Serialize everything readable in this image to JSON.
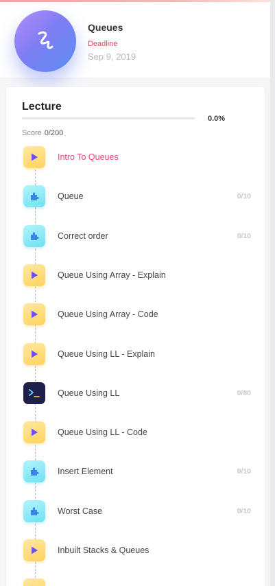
{
  "header": {
    "title": "Queues",
    "deadline_label": "Deadline",
    "deadline_date": "Sep 9, 2019",
    "avatar_icon": "squiggle-logo-icon"
  },
  "lecture": {
    "title": "Lecture",
    "progress_text": "0.0%",
    "progress_value": 0.0,
    "score_label": "Score",
    "score_value": "0/200"
  },
  "colors": {
    "active": "#e8437a",
    "deadline": "#e8435a",
    "video_icon": "#ffd35c",
    "puzzle_icon": "#6fe1f3",
    "code_icon": "#1e1f4a"
  },
  "items": [
    {
      "label": "Intro To Queues",
      "type": "video",
      "icon": "play-icon",
      "score": "",
      "active": true
    },
    {
      "label": "Queue",
      "type": "puzzle",
      "icon": "puzzle-icon",
      "score": "0/10",
      "active": false
    },
    {
      "label": "Correct order",
      "type": "puzzle",
      "icon": "puzzle-icon",
      "score": "0/10",
      "active": false
    },
    {
      "label": "Queue Using Array - Explain",
      "type": "video",
      "icon": "play-icon",
      "score": "",
      "active": false
    },
    {
      "label": "Queue Using Array - Code",
      "type": "video",
      "icon": "play-icon",
      "score": "",
      "active": false
    },
    {
      "label": "Queue Using LL - Explain",
      "type": "video",
      "icon": "play-icon",
      "score": "",
      "active": false
    },
    {
      "label": "Queue Using LL",
      "type": "code",
      "icon": "terminal-icon",
      "score": "0/80",
      "active": false
    },
    {
      "label": "Queue Using LL - Code",
      "type": "video",
      "icon": "play-icon",
      "score": "",
      "active": false
    },
    {
      "label": "Insert Element",
      "type": "puzzle",
      "icon": "puzzle-icon",
      "score": "0/10",
      "active": false
    },
    {
      "label": "Worst Case",
      "type": "puzzle",
      "icon": "puzzle-icon",
      "score": "0/10",
      "active": false
    },
    {
      "label": "Inbuilt Stacks & Queues",
      "type": "video",
      "icon": "play-icon",
      "score": "",
      "active": false
    },
    {
      "label": "",
      "type": "video",
      "icon": "play-icon",
      "score": "",
      "active": false
    }
  ]
}
